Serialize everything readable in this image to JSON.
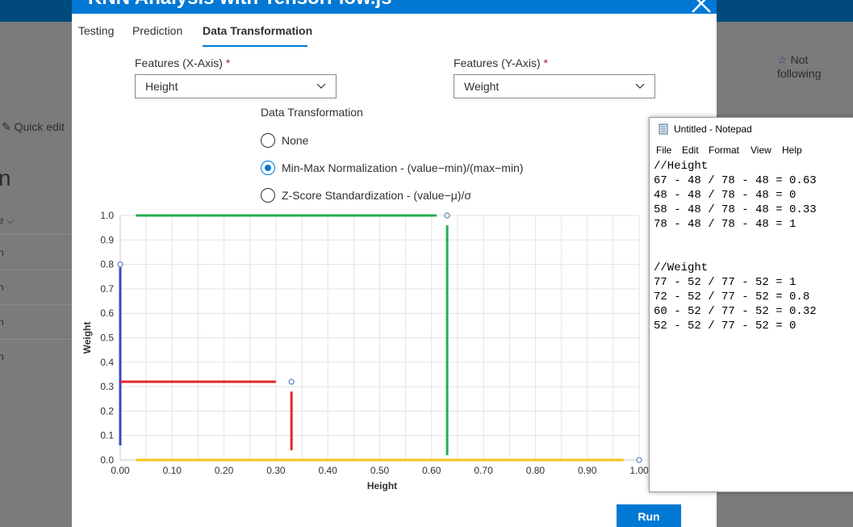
{
  "background": {
    "not_following": "Not following",
    "quick_edit": "Quick edit",
    "fragment_heading": "n",
    "fragment_col": "e",
    "fragment_rows": [
      "n",
      "n",
      "n",
      "n"
    ]
  },
  "dialog": {
    "title": "KNN Analysis with TensorFlow.js",
    "tabs": [
      {
        "label": "Testing"
      },
      {
        "label": "Prediction"
      },
      {
        "label": "Data Transformation"
      }
    ],
    "features_x": {
      "label": "Features (X-Axis)",
      "required_mark": "*",
      "value": "Height"
    },
    "features_y": {
      "label": "Features (Y-Axis)",
      "required_mark": "*",
      "value": "Weight"
    },
    "transformation": {
      "label": "Data Transformation",
      "options": [
        {
          "label": "None",
          "checked": false
        },
        {
          "label": "Min-Max Normalization - (value−min)/(max−min)",
          "checked": true
        },
        {
          "label": "Z-Score Standardization - (value−μ)/σ",
          "checked": false
        }
      ]
    },
    "run_label": "Run"
  },
  "chart_data": {
    "type": "scatter",
    "xlabel": "Height",
    "ylabel": "Weight",
    "xlim": [
      0,
      1
    ],
    "ylim": [
      0,
      1
    ],
    "x_ticks": [
      "0.00",
      "0.10",
      "0.20",
      "0.30",
      "0.40",
      "0.50",
      "0.60",
      "0.70",
      "0.80",
      "0.90",
      "1.00"
    ],
    "y_ticks": [
      "0.0",
      "0.1",
      "0.2",
      "0.3",
      "0.4",
      "0.5",
      "0.6",
      "0.7",
      "0.8",
      "0.9",
      "1.0"
    ],
    "grid": true,
    "points": [
      {
        "x": 0.63,
        "y": 1,
        "color": "#7a96c8"
      },
      {
        "x": 0,
        "y": 0.8,
        "color": "#7a96c8"
      },
      {
        "x": 0.33,
        "y": 0.32,
        "color": "#7a96c8"
      },
      {
        "x": 1,
        "y": 0,
        "color": "#7a96c8"
      }
    ],
    "guide_colors": [
      "#27ae50",
      "#3a47c0",
      "#e0282c",
      "#f5c518"
    ]
  },
  "notepad": {
    "title": "Untitled - Notepad",
    "menu": [
      "File",
      "Edit",
      "Format",
      "View",
      "Help"
    ],
    "text": "//Height\n67 - 48 / 78 - 48 = 0.63\n48 - 48 / 78 - 48 = 0\n58 - 48 / 78 - 48 = 0.33\n78 - 48 / 78 - 48 = 1\n\n\n//Weight\n77 - 52 / 77 - 52 = 1\n72 - 52 / 77 - 52 = 0.8\n60 - 52 / 77 - 52 = 0.32\n52 - 52 / 77 - 52 = 0"
  },
  "colors": {
    "accent": "#0078d4",
    "required": "#a4262c",
    "topbar": "#004a7e"
  }
}
